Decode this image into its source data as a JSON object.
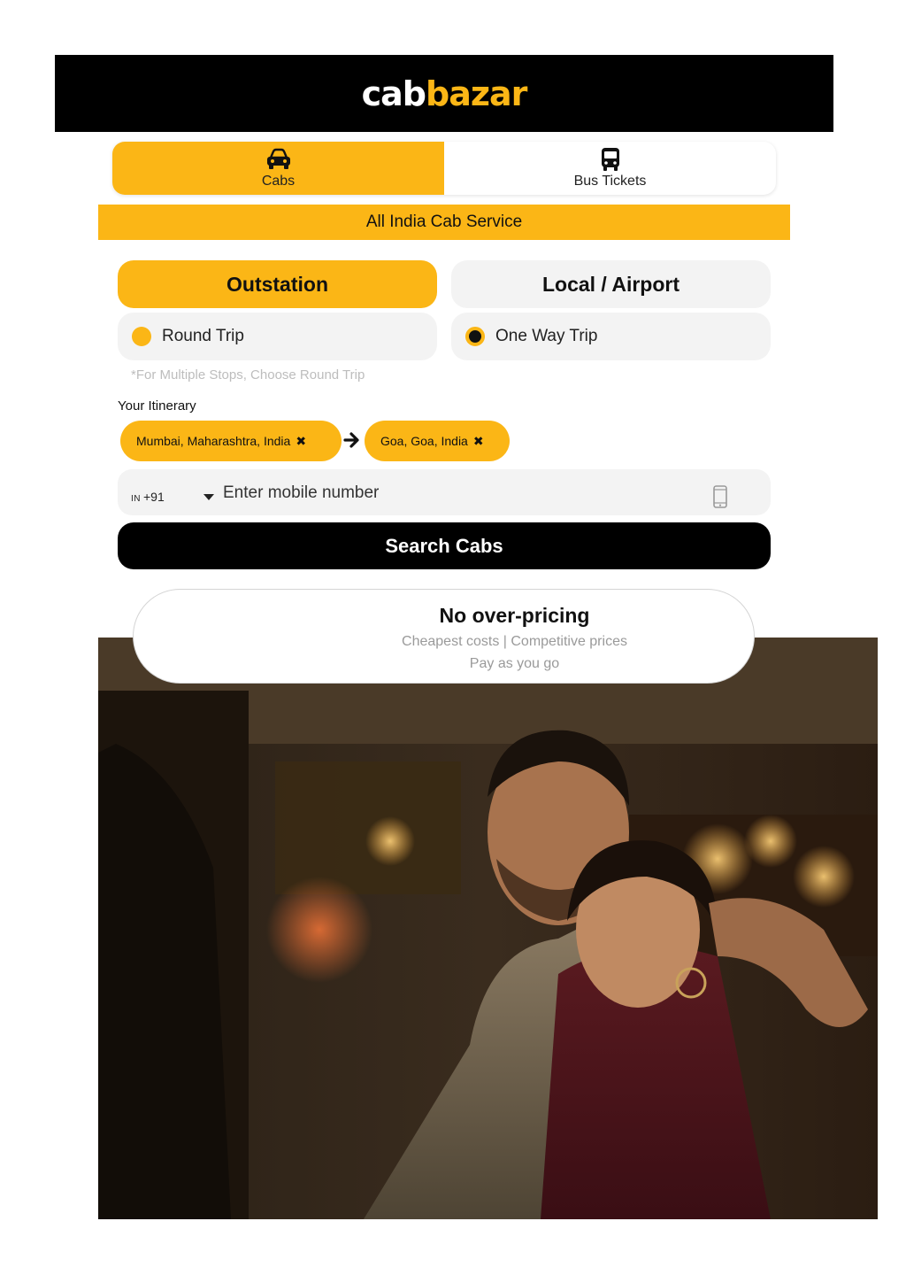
{
  "brand": {
    "logo_part1": "cab",
    "logo_part2": "bazar",
    "accent": "#fbb616",
    "dark": "#000000"
  },
  "tabs": [
    {
      "label": "Cabs",
      "icon": "car-icon",
      "active": true
    },
    {
      "label": "Bus Tickets",
      "icon": "bus-icon",
      "active": false
    }
  ],
  "banner": "All India Cab Service",
  "service": {
    "outstation": "Outstation",
    "local": "Local / Airport",
    "selected": "Outstation"
  },
  "trip": {
    "round": "Round Trip",
    "oneway": "One Way Trip",
    "selected": "One Way Trip"
  },
  "hint": "*For Multiple Stops, Choose Round Trip",
  "itinerary": {
    "label": "Your Itinerary",
    "from": "Mumbai, Maharashtra, India",
    "to": "Goa, Goa, India"
  },
  "phone": {
    "country_code": "IN",
    "dial_code": "+91",
    "placeholder": "Enter mobile number",
    "value": ""
  },
  "search_button": "Search Cabs",
  "info_card": {
    "title": "No over-pricing",
    "line1": "Cheapest costs | Competitive prices",
    "line2": "Pay as you go"
  },
  "hero_image": {
    "subject": "couple-in-cab-photo"
  }
}
